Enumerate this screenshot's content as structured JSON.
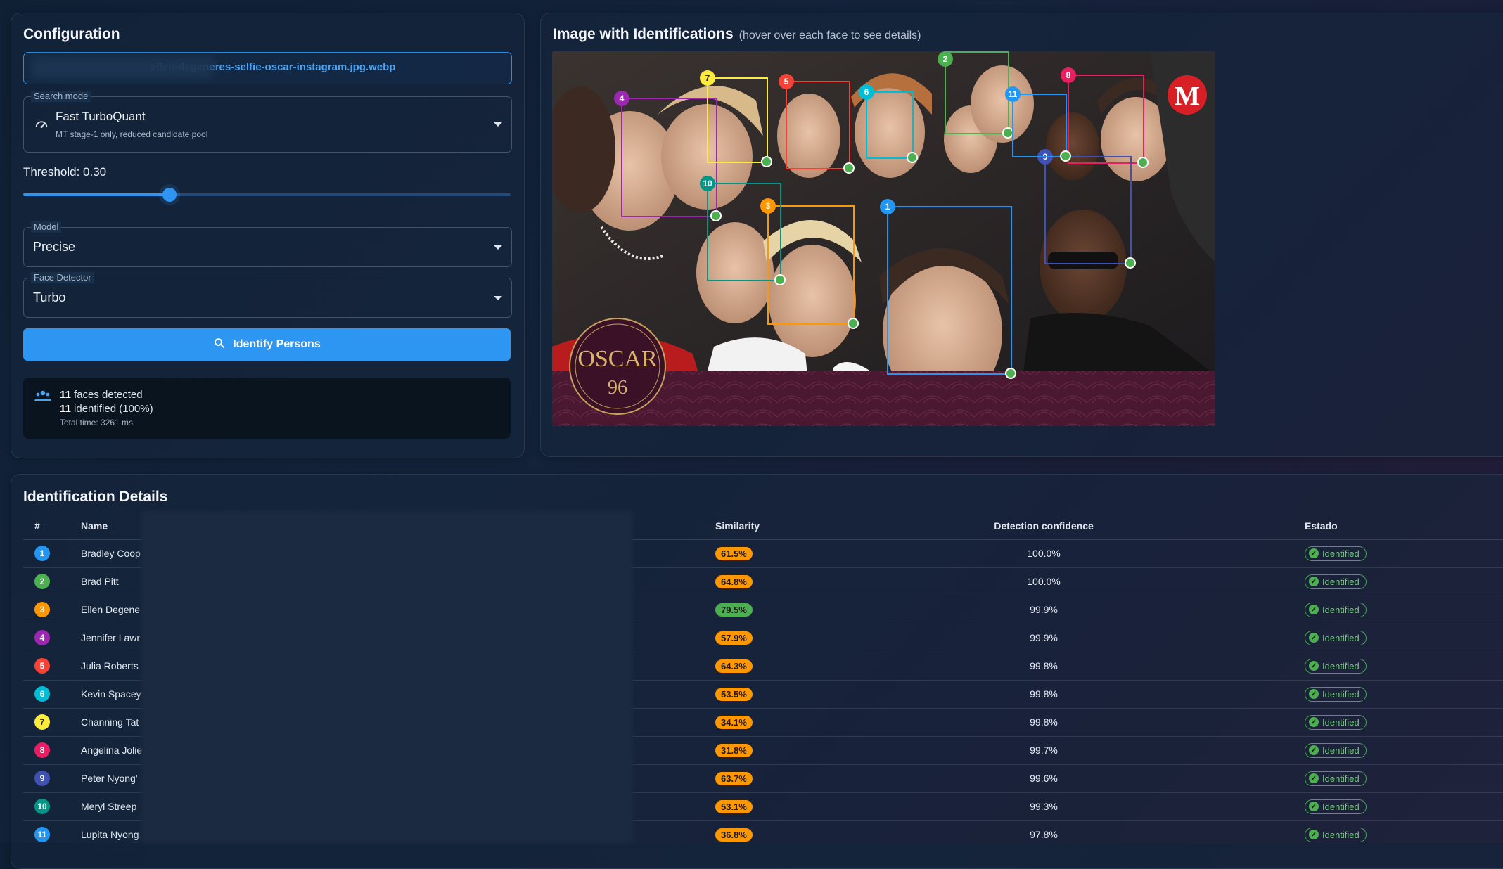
{
  "config": {
    "title": "Configuration",
    "file_name": "ellen-degeneres-selfie-oscar-instagram.jpg.webp",
    "search_mode": {
      "legend": "Search mode",
      "value": "Fast TurboQuant",
      "description": "MT stage-1 only, reduced candidate pool"
    },
    "threshold": {
      "label": "Threshold: 0.30",
      "value": 0.3
    },
    "model": {
      "legend": "Model",
      "value": "Precise"
    },
    "detector": {
      "legend": "Face Detector",
      "value": "Turbo"
    },
    "identify_button": "Identify Persons",
    "result": {
      "faces_count": "11",
      "faces_text": "faces detected",
      "identified_count": "11",
      "identified_text": "identified (100%)",
      "total_time": "Total time: 3261 ms"
    }
  },
  "image_panel": {
    "title": "Image with Identifications",
    "hint": "(hover over each face to see details)"
  },
  "details": {
    "title": "Identification Details",
    "columns": {
      "index": "#",
      "name": "Name",
      "similarity": "Similarity",
      "detection": "Detection confidence",
      "status": "Estado"
    },
    "rows": [
      {
        "n": "1",
        "name": "Bradley Coop",
        "similarity": "61.5%",
        "detection": "100.0%",
        "status": "Identified",
        "color": "#2196f3",
        "sim_color": "#ff9800"
      },
      {
        "n": "2",
        "name": "Brad Pitt",
        "similarity": "64.8%",
        "detection": "100.0%",
        "status": "Identified",
        "color": "#4caf50",
        "sim_color": "#ff9800"
      },
      {
        "n": "3",
        "name": "Ellen Degene",
        "similarity": "79.5%",
        "detection": "99.9%",
        "status": "Identified",
        "color": "#ff9800",
        "sim_color": "#4caf50"
      },
      {
        "n": "4",
        "name": "Jennifer Lawr",
        "similarity": "57.9%",
        "detection": "99.9%",
        "status": "Identified",
        "color": "#9c27b0",
        "sim_color": "#ff9800"
      },
      {
        "n": "5",
        "name": "Julia Roberts",
        "similarity": "64.3%",
        "detection": "99.8%",
        "status": "Identified",
        "color": "#f44336",
        "sim_color": "#ff9800"
      },
      {
        "n": "6",
        "name": "Kevin Spacey",
        "similarity": "53.5%",
        "detection": "99.8%",
        "status": "Identified",
        "color": "#00bcd4",
        "sim_color": "#ff9800"
      },
      {
        "n": "7",
        "name": "Channing Tat",
        "similarity": "34.1%",
        "detection": "99.8%",
        "status": "Identified",
        "color": "#ffeb3b",
        "sim_color": "#ff9800"
      },
      {
        "n": "8",
        "name": "Angelina Jolie",
        "similarity": "31.8%",
        "detection": "99.7%",
        "status": "Identified",
        "color": "#e91e63",
        "sim_color": "#ff9800"
      },
      {
        "n": "9",
        "name": "Peter Nyong'",
        "similarity": "63.7%",
        "detection": "99.6%",
        "status": "Identified",
        "color": "#3f51b5",
        "sim_color": "#ff9800"
      },
      {
        "n": "10",
        "name": "Meryl Streep",
        "similarity": "53.1%",
        "detection": "99.3%",
        "status": "Identified",
        "color": "#009688",
        "sim_color": "#ff9800"
      },
      {
        "n": "11",
        "name": "Lupita Nyong",
        "similarity": "36.8%",
        "detection": "97.8%",
        "status": "Identified",
        "color": "#2196f3",
        "sim_color": "#ff9800"
      }
    ]
  },
  "faces": [
    {
      "n": "1",
      "color": "#2196f3"
    },
    {
      "n": "2",
      "color": "#4caf50"
    },
    {
      "n": "3",
      "color": "#ff9800"
    },
    {
      "n": "4",
      "color": "#9c27b0"
    },
    {
      "n": "5",
      "color": "#f44336"
    },
    {
      "n": "6",
      "color": "#00bcd4"
    },
    {
      "n": "7",
      "color": "#ffeb3b"
    },
    {
      "n": "8",
      "color": "#e91e63"
    },
    {
      "n": "9",
      "color": "#3f51b5"
    },
    {
      "n": "10",
      "color": "#009688"
    },
    {
      "n": "11",
      "color": "#2196f3"
    }
  ],
  "photo": {
    "logo_letter": "M",
    "oscar_text": "OSCAR",
    "oscar_number": "96"
  }
}
